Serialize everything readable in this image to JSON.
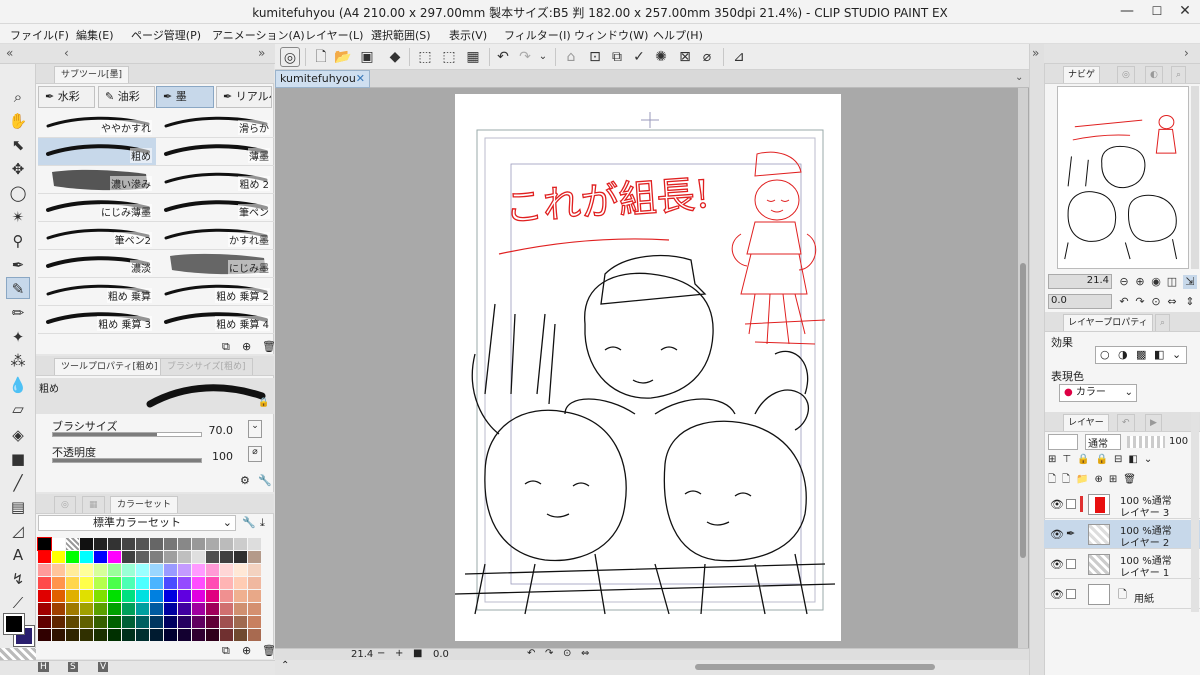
{
  "window": {
    "title": "kumitefuhyou (A4 210.00 x 297.00mm 製本サイズ:B5 判 182.00 x 257.00mm 350dpi 21.4%) - CLIP STUDIO PAINT EX",
    "minimize": "—",
    "maximize": "☐",
    "close": "✕"
  },
  "menu": [
    "ファイル(F)",
    "編集(E)",
    "ページ管理(P)",
    "アニメーション(A)",
    "レイヤー(L)",
    "選択範囲(S)",
    "表示(V)",
    "フィルター(I)",
    "ウィンドウ(W)",
    "ヘルプ(H)"
  ],
  "subtool": {
    "tab_label": "サブツール[墨]",
    "groups": [
      "水彩",
      "油彩",
      "墨",
      "リアルペ"
    ],
    "brushes_left": [
      "ややかすれ",
      "粗め",
      "濃い滲み",
      "にじみ薄墨",
      "筆ペン2",
      "濃淡",
      "粗め 乗算",
      "粗め 乗算 3"
    ],
    "brushes_right": [
      "滑らか",
      "薄墨",
      "粗め 2",
      "筆ペン",
      "かすれ墨",
      "にじみ墨",
      "粗め 乗算 2",
      "粗め 乗算 4"
    ]
  },
  "tool_property": {
    "tab_label": "ツールプロパティ[粗め]",
    "tab2_label": "ブラシサイズ[粗め]",
    "preset_name": "粗め",
    "brush_size_label": "ブラシサイズ",
    "brush_size_value": "70.0",
    "brush_size_fraction": 0.7,
    "opacity_label": "不透明度",
    "opacity_value": "100",
    "opacity_fraction": 1.0
  },
  "colorset": {
    "tab_label": "カラーセット",
    "set_name": "標準カラーセット"
  },
  "color_indicator": {
    "main_color": "#000000",
    "sub_color": "#2a1f6e"
  },
  "canvas": {
    "doc_tab": "kumitefuhyou",
    "sketch_text": "これが組長!",
    "zoom": "21.4",
    "angle": "0.0"
  },
  "navigator": {
    "tab_label": "ナビゲ",
    "zoom": "21.4",
    "angle": "0.0"
  },
  "layer_property": {
    "tab_label": "レイヤープロパティ",
    "effect_label": "効果",
    "display_color_label": "表現色",
    "display_color_value": "カラー"
  },
  "layers_panel": {
    "tab_label": "レイヤー",
    "blend_mode": "通常",
    "opacity": "100",
    "layers": [
      {
        "percent": "100 %通常",
        "name": "レイヤー 3"
      },
      {
        "percent": "100 %通常",
        "name": "レイヤー 2"
      },
      {
        "percent": "100 %通常",
        "name": "レイヤー 1"
      },
      {
        "percent": "",
        "name": "用紙"
      }
    ]
  },
  "bottom_letters": [
    "H",
    "S",
    "V"
  ],
  "icons": [
    "hand-icon",
    "zoom-icon",
    "pen-icon",
    "eraser-icon",
    "eye-icon",
    "undo-icon",
    "redo-icon",
    "trash-icon"
  ]
}
